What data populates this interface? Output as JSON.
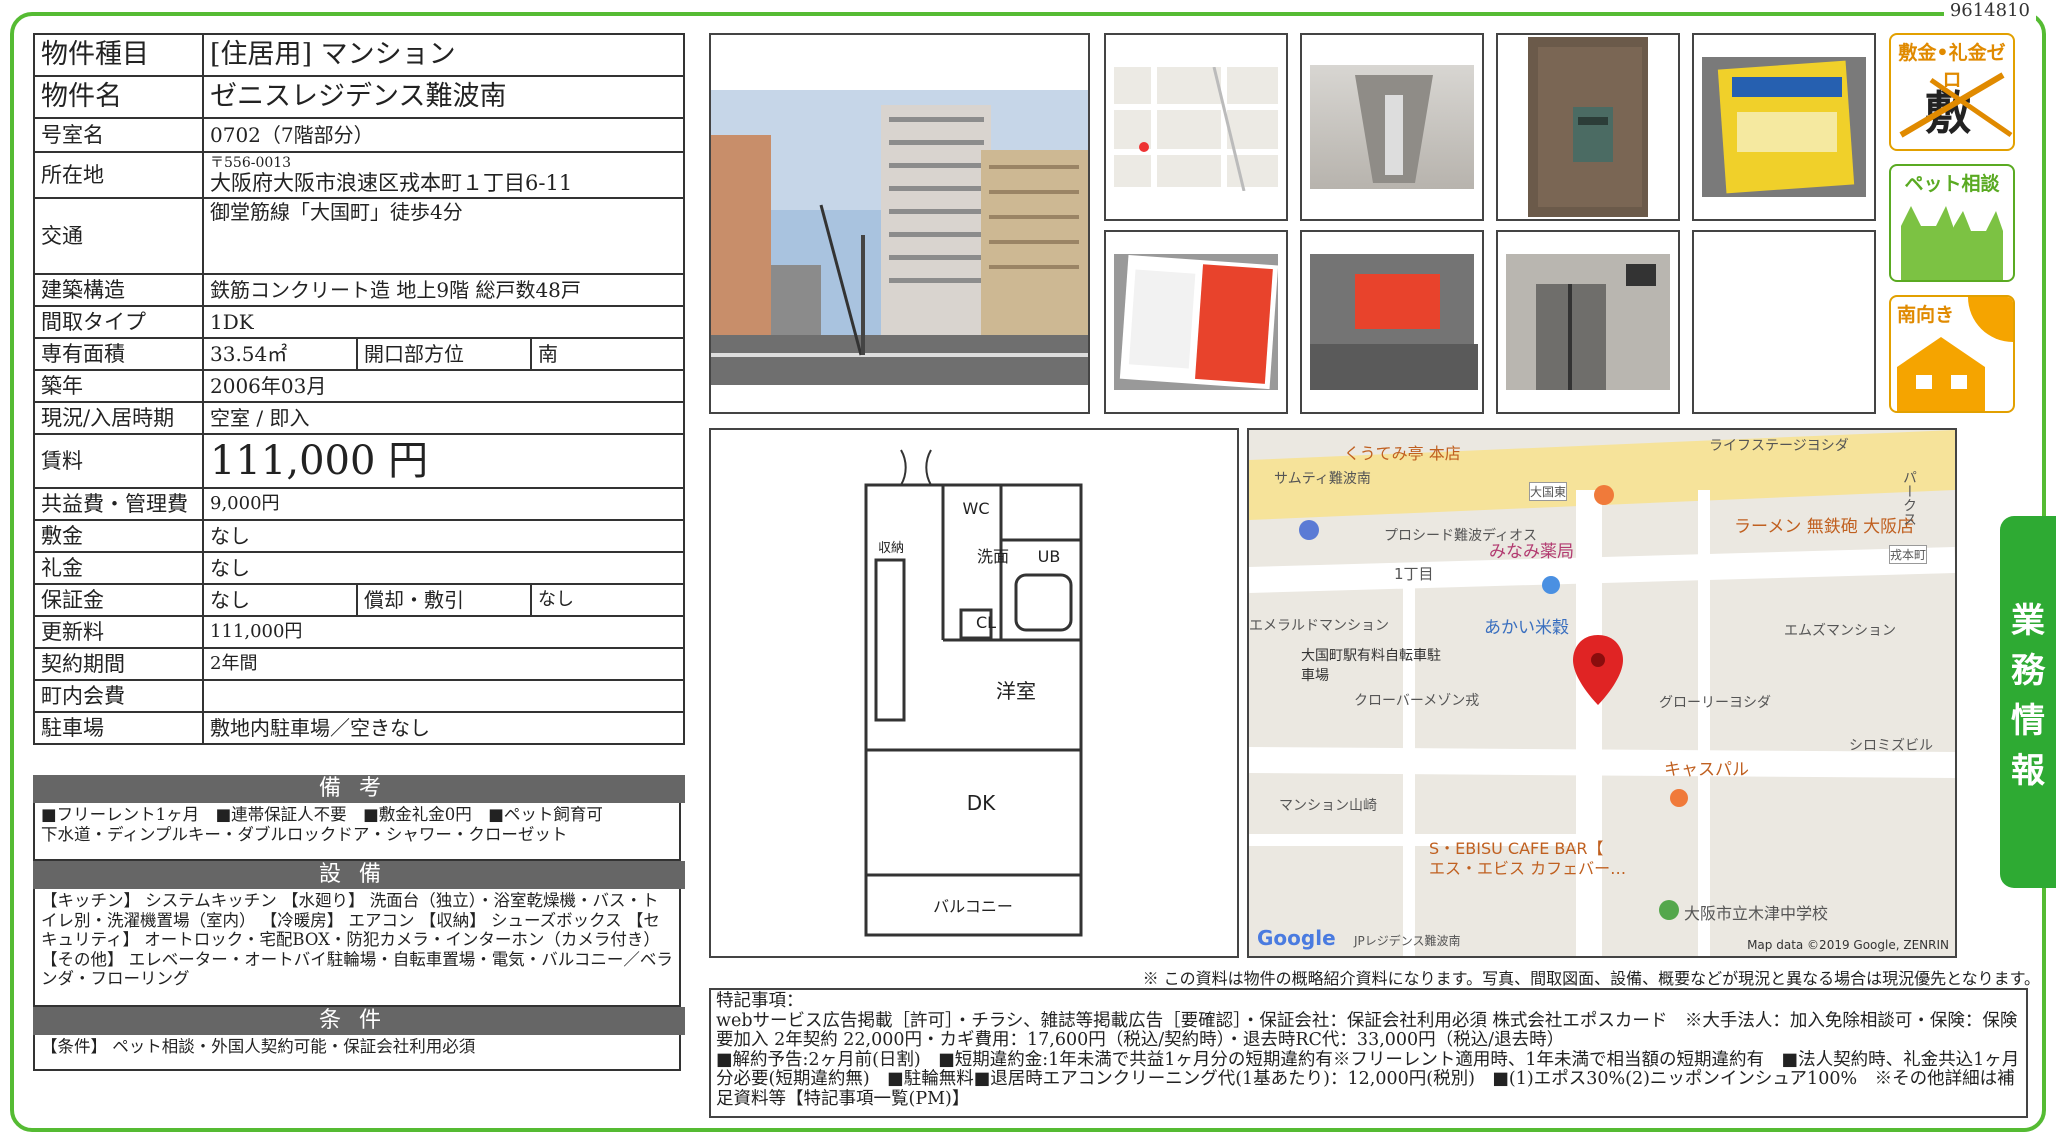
{
  "doc_id": "9614810",
  "property": {
    "type_label": "物件種目",
    "type_value": "[住居用] マンション",
    "name_label": "物件名",
    "name_value": "ゼニスレジデンス難波南",
    "room_label": "号室名",
    "room_value": "0702（7階部分）",
    "address_label": "所在地",
    "postal": "〒556-0013",
    "address": "大阪府大阪市浪速区戎本町１丁目6-11",
    "transport_label": "交通",
    "transport_value": "御堂筋線「大国町」徒歩4分",
    "structure_label": "建築構造",
    "structure_value": "鉄筋コンクリート造 地上9階 総戸数48戸",
    "layout_label": "間取タイプ",
    "layout_value": "1DK",
    "area_label": "専有面積",
    "area_value": "33.54㎡",
    "direction_label": "開口部方位",
    "direction_value": "南",
    "built_label": "築年",
    "built_value": "2006年03月",
    "status_label": "現況/入居時期",
    "status_value": "空室 / 即入",
    "rent_label": "賃料",
    "rent_value": "111,000 円",
    "fee_label": "共益費・管理費",
    "fee_value": "9,000円",
    "deposit_label": "敷金",
    "deposit_value": "なし",
    "keymoney_label": "礼金",
    "keymoney_value": "なし",
    "guarantee_label": "保証金",
    "guarantee_value": "なし",
    "amort_label": "償却・敷引",
    "amort_value": "なし",
    "renewal_label": "更新料",
    "renewal_value": "111,000円",
    "contract_label": "契約期間",
    "contract_value": "2年間",
    "town_label": "町内会費",
    "town_value": "",
    "parking_label": "駐車場",
    "parking_value": "敷地内駐車場／空きなし"
  },
  "sections": {
    "remarks_title": "備考",
    "remarks_text": "■フリーレント1ヶ月　■連帯保証人不要　■敷金礼金0円　■ペット飼育可\n下水道・ディンプルキー・ダブルロックドア・シャワー・クローゼット",
    "equipment_title": "設備",
    "equipment_text": "【キッチン】 システムキッチン 【水廻り】 洗面台（独立）・浴室乾燥機・バス・トイレ別・洗濯機置場（室内） 【冷暖房】 エアコン 【収納】 シューズボックス 【セキュリティ】 オートロック・宅配BOX・防犯カメラ・インターホン（カメラ付き） 【その他】 エレベーター・オートバイ駐輪場・自転車置場・電気・バルコニー／ベランダ・フローリング",
    "conditions_title": "条件",
    "conditions_text": "【条件】 ペット相談・外国人契約可能・保証会社利用必須"
  },
  "badges": {
    "zero": "敷金•礼金ゼロ",
    "zero_cross": "敷 礼",
    "pet": "ペット相談",
    "south": "南向き"
  },
  "side_tab": "業務情報",
  "floorplan": {
    "labels": [
      "洗面",
      "UB",
      "CL",
      "洋室",
      "DK",
      "バルコニー",
      "収納",
      "WC"
    ]
  },
  "map": {
    "labels": [
      "くうてみ亭 本店",
      "サムティ難波南",
      "大国東",
      "ライフステージヨシダ",
      "ラーメン 無鉄砲 大阪店",
      "プロシード難波ディオス",
      "みなみ薬局",
      "戎本町",
      "1丁目",
      "あかい米穀",
      "エメラルドマンション",
      "大国町駅有料自転車駐車場",
      "クローバーメゾン戎",
      "エムズマンション",
      "グローリーヨシダ",
      "キャスパル",
      "シロミズビル",
      "マンション山崎",
      "S・EBISU CAFE BAR【",
      "エス・エビス カフェバー…",
      "大阪市立木津中学校",
      "JPレジデンス難波南",
      "パークス"
    ],
    "copyright": "Map data ©2019 Google, ZENRIN",
    "logo": "Google"
  },
  "disclaimer": "※ この資料は物件の概略紹介資料になります。写真、間取図面、設備、概要などが現況と異なる場合は現況優先となります。",
  "special": {
    "title": "特記事項：",
    "line1": "webサービス広告掲載［許可］・チラシ、雑誌等掲載広告［要確認］・保証会社：保証会社利用必須 株式会社エポスカード　※大手法人：加入免除相談可・保険：保険要加入 2年契約 22,000円・カギ費用：17,600円（税込/契約時）・退去時RC代：33,000円（税込/退去時）",
    "line2": "■解約予告:2ヶ月前(日割)　■短期違約金:1年未満で共益1ヶ月分の短期違約有※フリーレント適用時、1年未満で相当額の短期違約有　■法人契約時、礼金共込1ヶ月分必要(短期違約無)　■駐輪無料■退居時エアコンクリーニング代(1基あたり)：12,000円(税別)　■(1)エポス30%(2)ニッポンインシュア100%　※その他詳細は補足資料等【特記事項一覧(PM)】"
  }
}
